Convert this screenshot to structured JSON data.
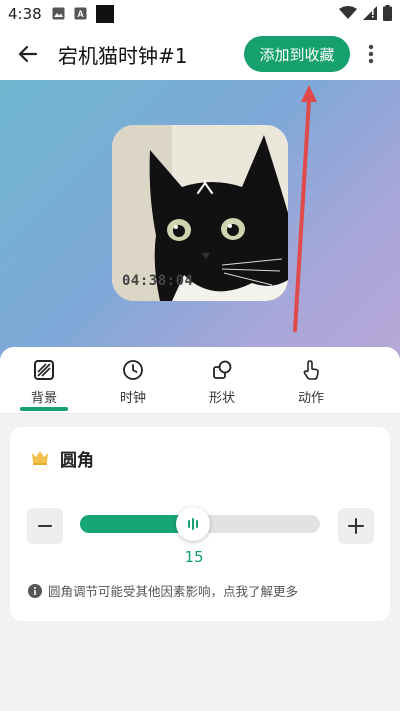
{
  "status_bar": {
    "time": "4:38"
  },
  "header": {
    "title": "宕机猫时钟#1",
    "add_favorite_label": "添加到收藏"
  },
  "preview": {
    "clock_text": "04:38:04"
  },
  "tabs": [
    {
      "label": "背景",
      "icon": "pattern-icon",
      "active": true
    },
    {
      "label": "时钟",
      "icon": "clock-icon",
      "active": false
    },
    {
      "label": "形状",
      "icon": "shapes-icon",
      "active": false
    },
    {
      "label": "动作",
      "icon": "touch-icon",
      "active": false
    }
  ],
  "corner_panel": {
    "title": "圆角",
    "slider_value": "15",
    "slider_fraction": 0.47,
    "hint": "圆角调节可能受其他因素影响，点我了解更多"
  },
  "colors": {
    "accent": "#16a06d",
    "arrow": "#e04a4a"
  }
}
